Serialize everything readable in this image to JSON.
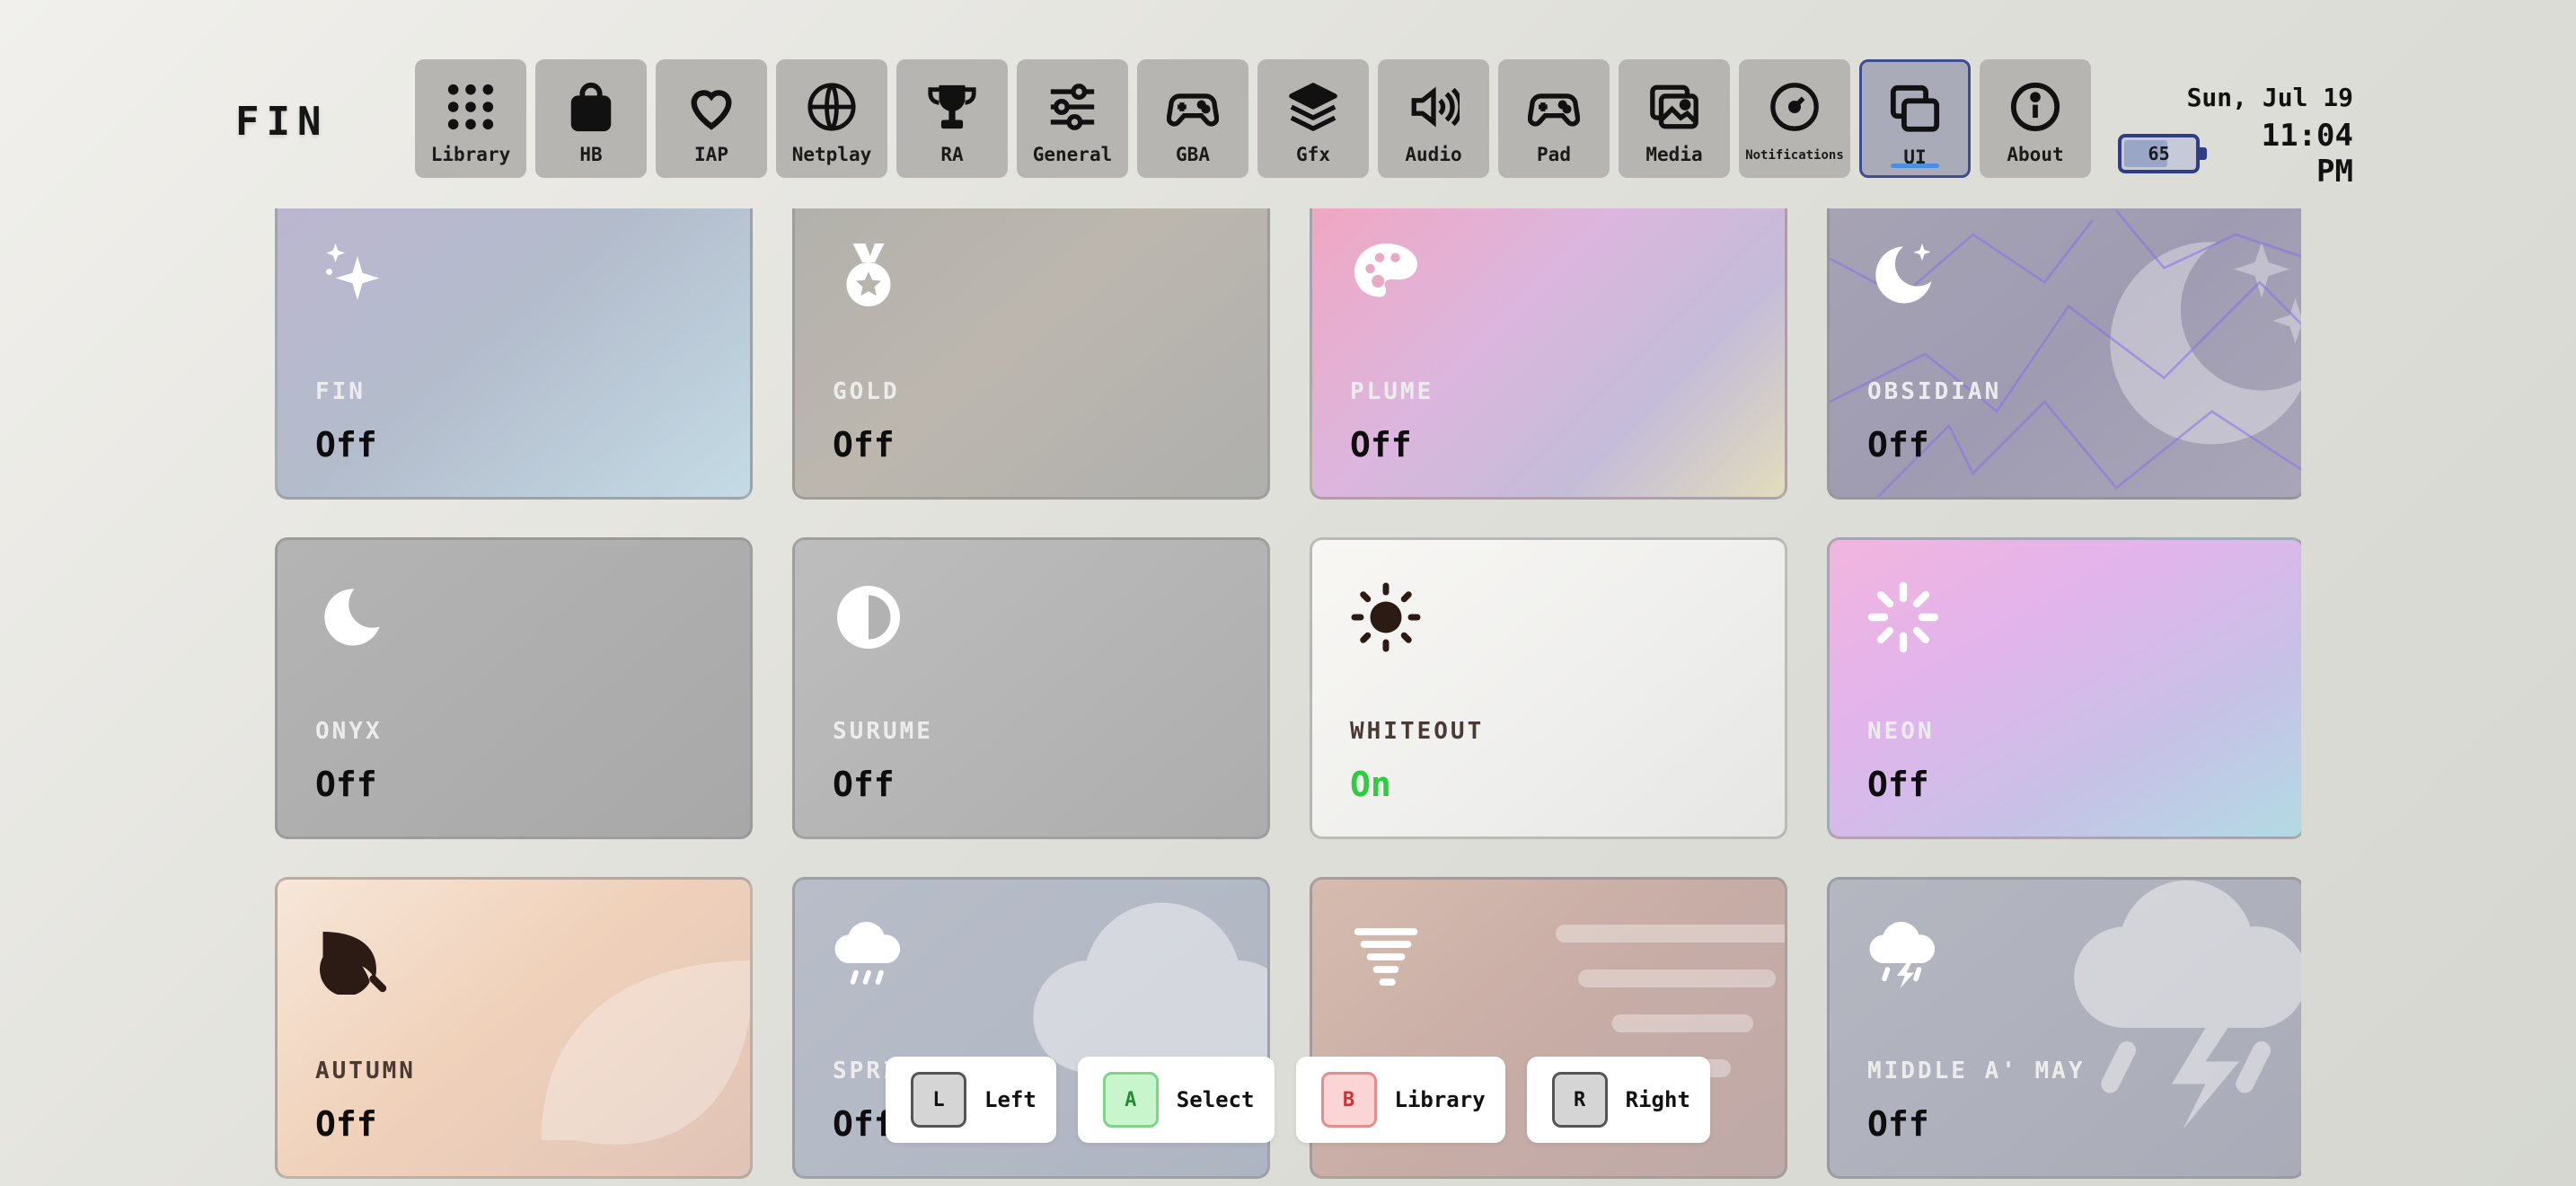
{
  "header": {
    "logo": "FIN",
    "date": "Sun, Jul 19",
    "time": "11:04 PM",
    "battery": {
      "level": "65",
      "fraction": 0.65
    }
  },
  "tabs": [
    {
      "label": "Library",
      "icon": "grid-icon"
    },
    {
      "label": "HB",
      "icon": "shopping-bag-icon"
    },
    {
      "label": "IAP",
      "icon": "heart-icon"
    },
    {
      "label": "Netplay",
      "icon": "globe-icon"
    },
    {
      "label": "RA",
      "icon": "trophy-icon"
    },
    {
      "label": "General",
      "icon": "sliders-icon"
    },
    {
      "label": "GBA",
      "icon": "gamepad-icon"
    },
    {
      "label": "Gfx",
      "icon": "layers-icon"
    },
    {
      "label": "Audio",
      "icon": "speaker-icon"
    },
    {
      "label": "Pad",
      "icon": "gamepad-icon"
    },
    {
      "label": "Media",
      "icon": "images-icon"
    },
    {
      "label": "Notifications",
      "icon": "dashboard-icon"
    },
    {
      "label": "UI",
      "icon": "windows-icon",
      "active": true
    },
    {
      "label": "About",
      "icon": "info-icon"
    }
  ],
  "themes": [
    {
      "name": "FIN",
      "status": "Off",
      "icon": "sparkles-icon"
    },
    {
      "name": "GOLD",
      "status": "Off",
      "icon": "medal-icon"
    },
    {
      "name": "PLUME",
      "status": "Off",
      "icon": "palette-icon"
    },
    {
      "name": "OBSIDIAN",
      "status": "Off",
      "icon": "moon-stars-icon"
    },
    {
      "name": "ONYX",
      "status": "Off",
      "icon": "moon-icon"
    },
    {
      "name": "SURUME",
      "status": "Off",
      "icon": "half-circle-icon"
    },
    {
      "name": "WHITEOUT",
      "status": "On",
      "icon": "sun-icon"
    },
    {
      "name": "NEON",
      "status": "Off",
      "icon": "loader-icon"
    },
    {
      "name": "AUTUMN",
      "status": "Off",
      "icon": "leaf-icon"
    },
    {
      "name": "SPRING",
      "status": "Off",
      "icon": "cloud-rain-icon"
    },
    {
      "name": "",
      "status": "",
      "icon": "tornado-icon"
    },
    {
      "name": "MIDDLE A' MAY",
      "status": "Off",
      "icon": "cloud-lightning-icon"
    }
  ],
  "hints": [
    {
      "key": "L",
      "label": "Left"
    },
    {
      "key": "A",
      "label": "Select"
    },
    {
      "key": "B",
      "label": "Library"
    },
    {
      "key": "R",
      "label": "Right"
    }
  ],
  "colors": {
    "accent": "#2f3d86",
    "tab_underline": "#4a90e2",
    "on_status": "#2ecc40"
  }
}
